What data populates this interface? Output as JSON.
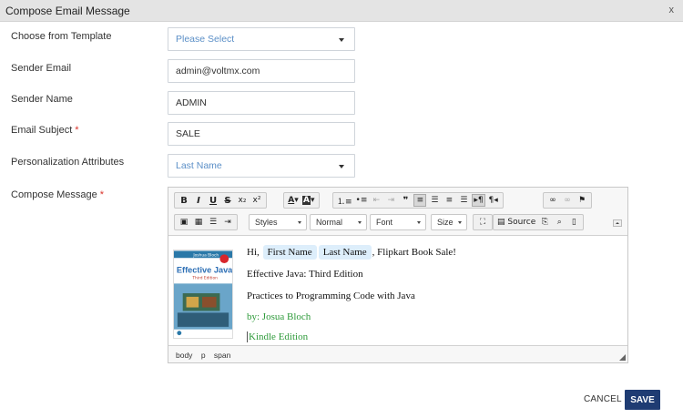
{
  "dialog": {
    "title": "Compose Email Message",
    "close_label": "x"
  },
  "form": {
    "template_label": "Choose from Template",
    "template_value": "Please Select",
    "sender_email_label": "Sender Email",
    "sender_email_value": "admin@voltmx.com",
    "sender_name_label": "Sender Name",
    "sender_name_value": "ADMIN",
    "subject_label": "Email Subject",
    "subject_value": "SALE",
    "personalization_label": "Personalization Attributes",
    "personalization_value": "Last Name",
    "compose_label": "Compose Message",
    "required_mark": "*"
  },
  "toolbar": {
    "styles": "Styles",
    "format": "Normal",
    "font": "Font",
    "size": "Size",
    "source": "Source"
  },
  "editor": {
    "greeting": "Hi,",
    "chip_first": "First Name",
    "chip_last": "Last Name",
    "greeting_tail": ", Flipkart Book Sale!",
    "line2": "Effective Java: Third Edition",
    "line3": "Practices to Programming Code with Java",
    "line4": "by: Josua Bloch",
    "line5": "Kindle Edition",
    "cover_author": "Joshua Bloch",
    "cover_title": "Effective Java",
    "cover_edition": "Third Edition",
    "path": [
      "body",
      "p",
      "span"
    ]
  },
  "actions": {
    "cancel": "CANCEL",
    "save": "SAVE"
  },
  "colors": {
    "accent": "#1f3c73",
    "link_green": "#2e9a3a",
    "chip_bg": "#ddeefb",
    "select_text": "#5b8fc7",
    "required": "#d9342b"
  }
}
